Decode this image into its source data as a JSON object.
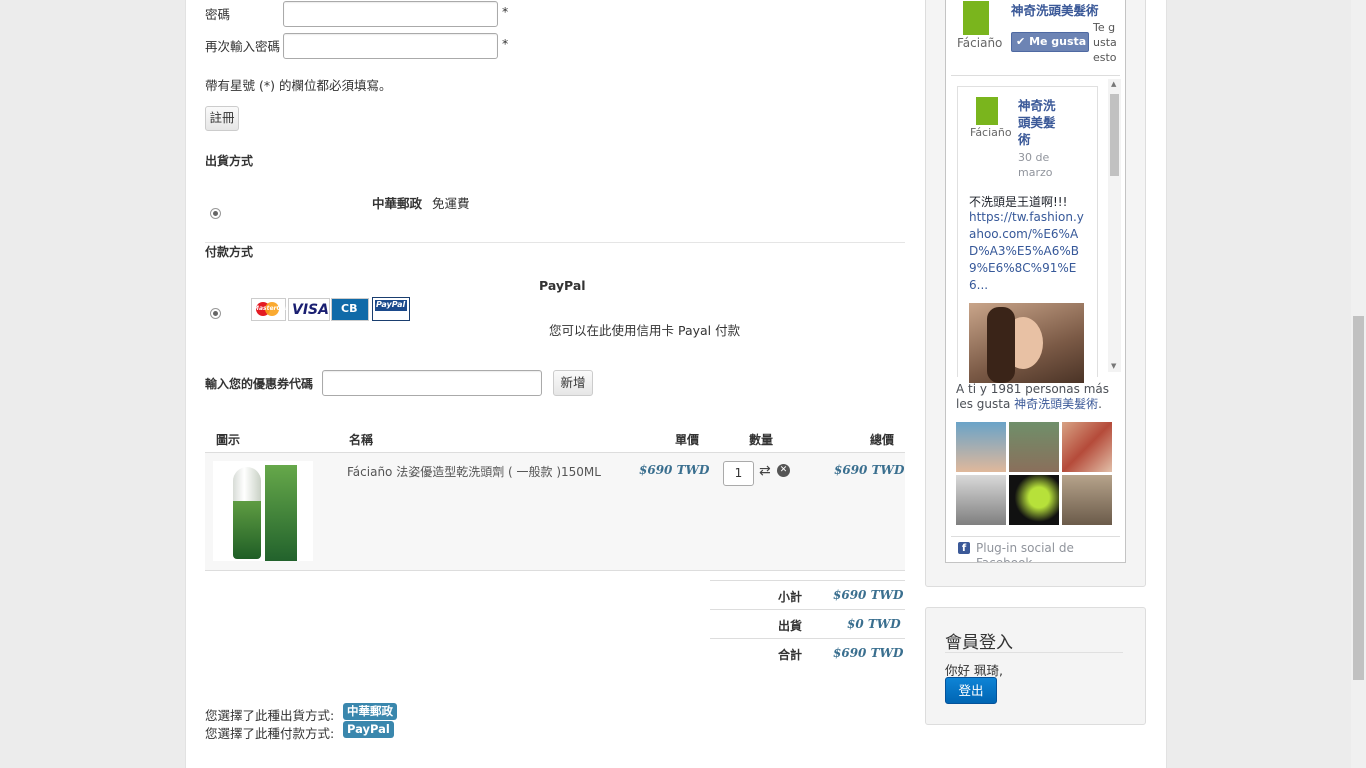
{
  "form": {
    "password_label": "密碼",
    "password_confirm_label": "再次輸入密碼",
    "required_mark": "*",
    "required_note": "帶有星號 (*) 的欄位都必須填寫。",
    "register_button": "註冊"
  },
  "shipping": {
    "heading": "出貨方式",
    "carrier": "中華郵政",
    "note": "免運費"
  },
  "payment": {
    "heading": "付款方式",
    "name": "PayPal",
    "description": "您可以在此使用信用卡 Payal 付款",
    "card_logos": [
      "MasterCard",
      "VISA",
      "CB",
      "PayPal"
    ]
  },
  "coupon": {
    "label": "輸入您的優惠券代碼",
    "value": "",
    "button": "新增"
  },
  "cart": {
    "headers": {
      "image": "圖示",
      "name": "名稱",
      "unit_price": "單價",
      "qty": "數量",
      "total": "總價"
    },
    "items": [
      {
        "name": "Fáciaño 法姿優造型乾洗頭劑 ( 一般款 )150ML",
        "unit_price": "$690 TWD",
        "qty": "1",
        "total": "$690 TWD"
      }
    ],
    "summary": [
      {
        "label": "小計",
        "value": "$690 TWD"
      },
      {
        "label": "出貨",
        "value": "$0 TWD"
      },
      {
        "label": "合計",
        "value": "$690 TWD"
      }
    ]
  },
  "selection": {
    "shipping_text": "您選擇了此種出貨方式:",
    "shipping_value": "中華郵政",
    "payment_text": "您選擇了此種付款方式:",
    "payment_value": "PayPal"
  },
  "facebook": {
    "page_name": "神奇洗頭美髮術",
    "like_button": "Me gusta",
    "like_side": "Te gusta esto",
    "logo_text": "Fáciaño",
    "post_author": "神奇洗頭美髮術",
    "post_date": "30 de marzo",
    "post_text": "不洗頭是王道啊!!!",
    "post_link": "https://tw.fashion.yahoo.com/%E6%AD%A3%E5%A6%B9%E6%8C%91%E6...",
    "likes_text_pre": "A ti y 1981 personas más les gusta ",
    "likes_text_page": "神奇洗頭美髮術",
    "likes_text_post": ".",
    "plugin_label": "Plug-in social de Facebook"
  },
  "login": {
    "heading": "會員登入",
    "greeting": "你好 珮琦,",
    "logout_button": "登出"
  },
  "colors": {
    "accent": "#3a87ad",
    "price": "#3a6f8f",
    "facebook": "#3b5998",
    "logout": "#0a75c9"
  }
}
